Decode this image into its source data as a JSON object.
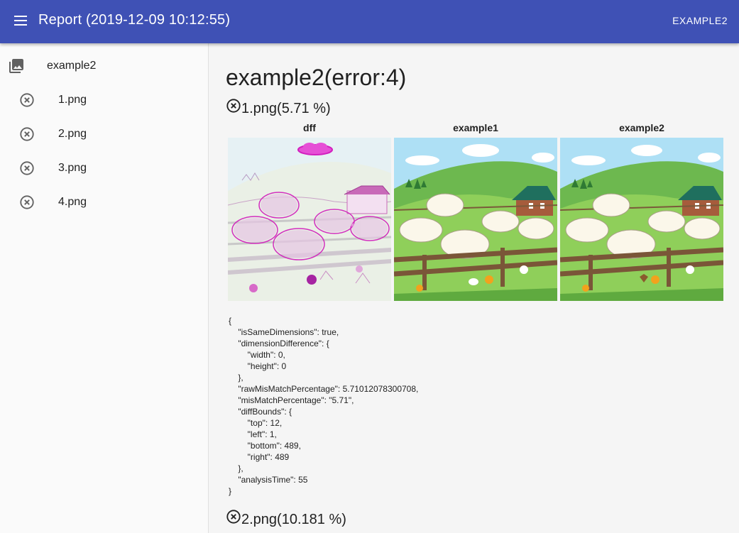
{
  "appbar": {
    "title": "Report (2019-12-09 10:12:55)",
    "action_label": "EXAMPLE2",
    "color": "#3f51b5"
  },
  "sidebar": {
    "header": {
      "icon": "photo-library-icon",
      "label": "example2"
    },
    "items": [
      {
        "icon": "cancel-circle-icon",
        "label": "1.png"
      },
      {
        "icon": "cancel-circle-icon",
        "label": "2.png"
      },
      {
        "icon": "cancel-circle-icon",
        "label": "3.png"
      },
      {
        "icon": "cancel-circle-icon",
        "label": "4.png"
      }
    ]
  },
  "main": {
    "title": "example2(error:4)",
    "results": [
      {
        "icon": "cancel-circle-icon",
        "title": "1.png(5.71 %)",
        "columns": [
          "dff",
          "example1",
          "example2"
        ],
        "json": "{\n    \"isSameDimensions\": true,\n    \"dimensionDifference\": {\n        \"width\": 0,\n        \"height\": 0\n    },\n    \"rawMisMatchPercentage\": 5.71012078300708,\n    \"misMatchPercentage\": \"5.71\",\n    \"diffBounds\": {\n        \"top\": 12,\n        \"left\": 1,\n        \"bottom\": 489,\n        \"right\": 489\n    },\n    \"analysisTime\": 55\n}"
      },
      {
        "icon": "cancel-circle-icon",
        "title": "2.png(10.181 %)"
      }
    ]
  }
}
